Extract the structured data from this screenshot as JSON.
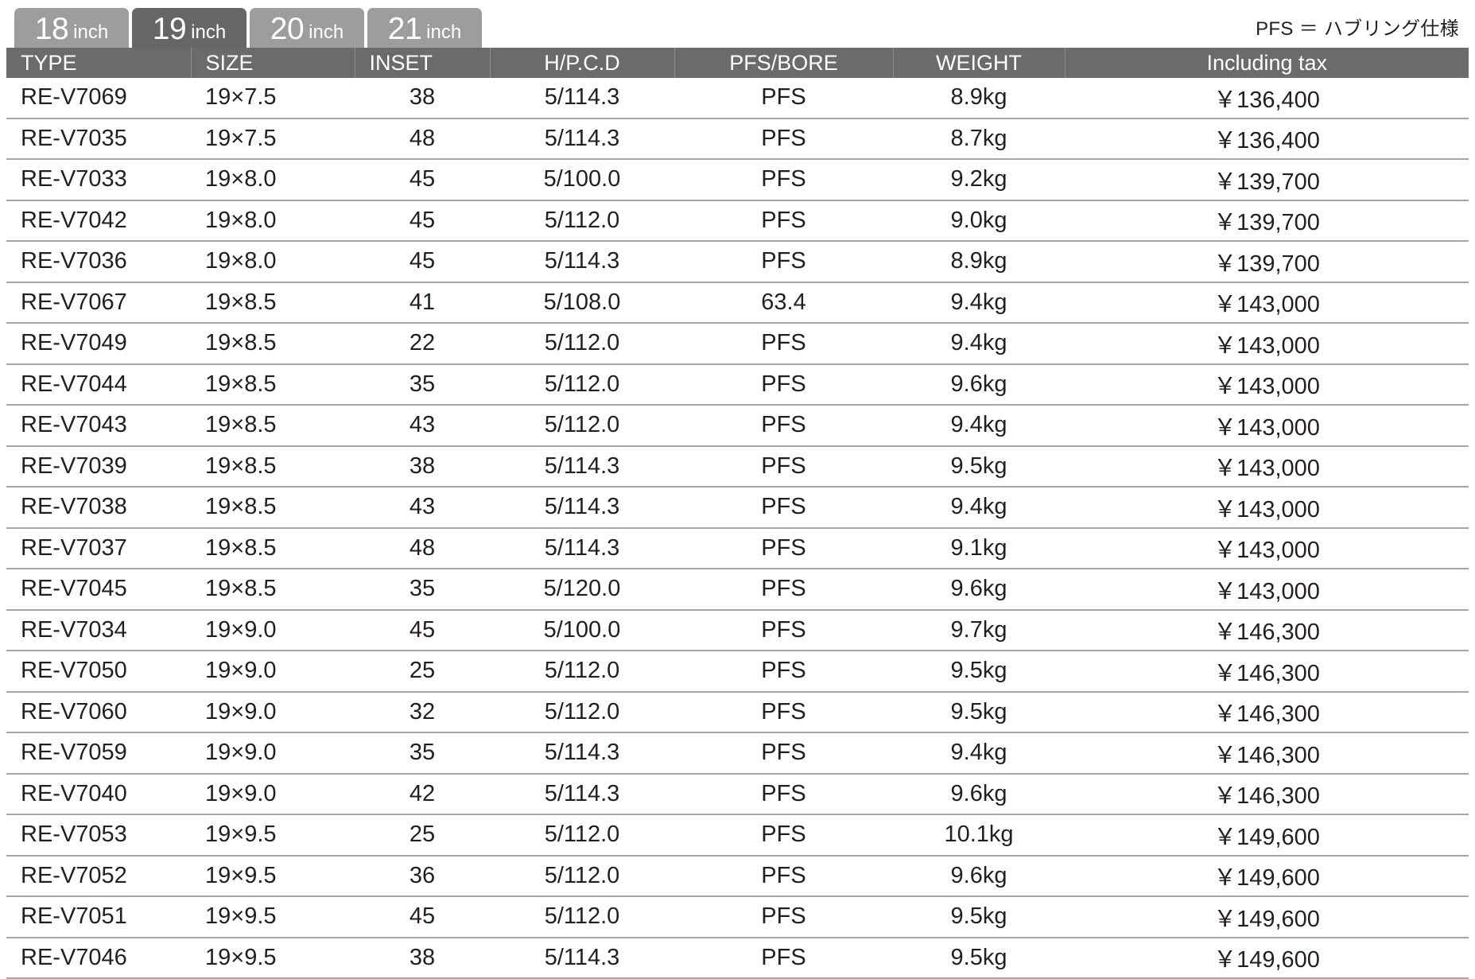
{
  "tabs": [
    {
      "num": "18",
      "unit": "inch",
      "active": false
    },
    {
      "num": "19",
      "unit": "inch",
      "active": true
    },
    {
      "num": "20",
      "unit": "inch",
      "active": false
    },
    {
      "num": "21",
      "unit": "inch",
      "active": false
    }
  ],
  "note": "PFS ＝ ハブリング仕様",
  "table": {
    "columns": [
      "TYPE",
      "SIZE",
      "INSET",
      "H/P.C.D",
      "PFS/BORE",
      "WEIGHT",
      "Including tax"
    ],
    "rows": [
      {
        "type": "RE-V7069",
        "size": "19×7.5",
        "inset": "38",
        "pcd": "5/114.3",
        "pfs": "PFS",
        "weight": "8.9kg",
        "price": "￥136,400"
      },
      {
        "type": "RE-V7035",
        "size": "19×7.5",
        "inset": "48",
        "pcd": "5/114.3",
        "pfs": "PFS",
        "weight": "8.7kg",
        "price": "￥136,400"
      },
      {
        "type": "RE-V7033",
        "size": "19×8.0",
        "inset": "45",
        "pcd": "5/100.0",
        "pfs": "PFS",
        "weight": "9.2kg",
        "price": "￥139,700"
      },
      {
        "type": "RE-V7042",
        "size": "19×8.0",
        "inset": "45",
        "pcd": "5/112.0",
        "pfs": "PFS",
        "weight": "9.0kg",
        "price": "￥139,700"
      },
      {
        "type": "RE-V7036",
        "size": "19×8.0",
        "inset": "45",
        "pcd": "5/114.3",
        "pfs": "PFS",
        "weight": "8.9kg",
        "price": "￥139,700"
      },
      {
        "type": "RE-V7067",
        "size": "19×8.5",
        "inset": "41",
        "pcd": "5/108.0",
        "pfs": "63.4",
        "weight": "9.4kg",
        "price": "￥143,000"
      },
      {
        "type": "RE-V7049",
        "size": "19×8.5",
        "inset": "22",
        "pcd": "5/112.0",
        "pfs": "PFS",
        "weight": "9.4kg",
        "price": "￥143,000"
      },
      {
        "type": "RE-V7044",
        "size": "19×8.5",
        "inset": "35",
        "pcd": "5/112.0",
        "pfs": "PFS",
        "weight": "9.6kg",
        "price": "￥143,000"
      },
      {
        "type": "RE-V7043",
        "size": "19×8.5",
        "inset": "43",
        "pcd": "5/112.0",
        "pfs": "PFS",
        "weight": "9.4kg",
        "price": "￥143,000"
      },
      {
        "type": "RE-V7039",
        "size": "19×8.5",
        "inset": "38",
        "pcd": "5/114.3",
        "pfs": "PFS",
        "weight": "9.5kg",
        "price": "￥143,000"
      },
      {
        "type": "RE-V7038",
        "size": "19×8.5",
        "inset": "43",
        "pcd": "5/114.3",
        "pfs": "PFS",
        "weight": "9.4kg",
        "price": "￥143,000"
      },
      {
        "type": "RE-V7037",
        "size": "19×8.5",
        "inset": "48",
        "pcd": "5/114.3",
        "pfs": "PFS",
        "weight": "9.1kg",
        "price": "￥143,000"
      },
      {
        "type": "RE-V7045",
        "size": "19×8.5",
        "inset": "35",
        "pcd": "5/120.0",
        "pfs": "PFS",
        "weight": "9.6kg",
        "price": "￥143,000"
      },
      {
        "type": "RE-V7034",
        "size": "19×9.0",
        "inset": "45",
        "pcd": "5/100.0",
        "pfs": "PFS",
        "weight": "9.7kg",
        "price": "￥146,300"
      },
      {
        "type": "RE-V7050",
        "size": "19×9.0",
        "inset": "25",
        "pcd": "5/112.0",
        "pfs": "PFS",
        "weight": "9.5kg",
        "price": "￥146,300"
      },
      {
        "type": "RE-V7060",
        "size": "19×9.0",
        "inset": "32",
        "pcd": "5/112.0",
        "pfs": "PFS",
        "weight": "9.5kg",
        "price": "￥146,300"
      },
      {
        "type": "RE-V7059",
        "size": "19×9.0",
        "inset": "35",
        "pcd": "5/114.3",
        "pfs": "PFS",
        "weight": "9.4kg",
        "price": "￥146,300"
      },
      {
        "type": "RE-V7040",
        "size": "19×9.0",
        "inset": "42",
        "pcd": "5/114.3",
        "pfs": "PFS",
        "weight": "9.6kg",
        "price": "￥146,300"
      },
      {
        "type": "RE-V7053",
        "size": "19×9.5",
        "inset": "25",
        "pcd": "5/112.0",
        "pfs": "PFS",
        "weight": "10.1kg",
        "price": "￥149,600"
      },
      {
        "type": "RE-V7052",
        "size": "19×9.5",
        "inset": "36",
        "pcd": "5/112.0",
        "pfs": "PFS",
        "weight": "9.6kg",
        "price": "￥149,600"
      },
      {
        "type": "RE-V7051",
        "size": "19×9.5",
        "inset": "45",
        "pcd": "5/112.0",
        "pfs": "PFS",
        "weight": "9.5kg",
        "price": "￥149,600"
      },
      {
        "type": "RE-V7046",
        "size": "19×9.5",
        "inset": "38",
        "pcd": "5/114.3",
        "pfs": "PFS",
        "weight": "9.5kg",
        "price": "￥149,600"
      }
    ]
  },
  "colors": {
    "header_bg": "#6b6b6b",
    "tab_active_bg": "#666666",
    "tab_inactive_bg": "#9d9d9d",
    "row_divider": "#a6a6a6",
    "text": "#231f20"
  }
}
